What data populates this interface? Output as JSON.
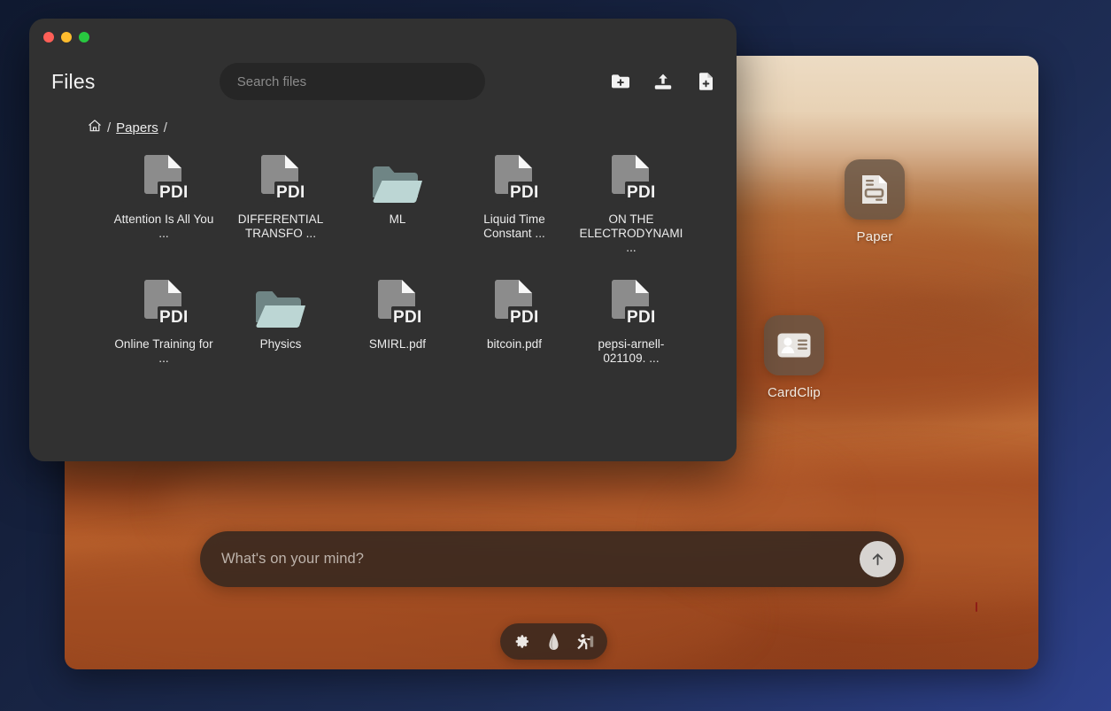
{
  "desktop": {
    "wallpaper_name": "desert-dunes-wallpaper",
    "icons": [
      {
        "id": "paper",
        "label": "Paper",
        "icon": "document-app-icon"
      },
      {
        "id": "cardclip",
        "label": "CardClip",
        "icon": "contact-card-app-icon"
      }
    ],
    "chat": {
      "placeholder": "What's on your mind?",
      "value": "",
      "send_icon": "arrow-up-icon"
    },
    "dock": {
      "items": [
        {
          "id": "settings",
          "icon": "gear-icon"
        },
        {
          "id": "lamp",
          "icon": "lamp-icon"
        },
        {
          "id": "exit",
          "icon": "exit-run-icon"
        }
      ]
    }
  },
  "files_window": {
    "title": "Files",
    "traffic_lights": [
      {
        "name": "close",
        "color": "#ff5f57"
      },
      {
        "name": "minimize",
        "color": "#febc2e"
      },
      {
        "name": "maximize",
        "color": "#28c840"
      }
    ],
    "search": {
      "placeholder": "Search files",
      "value": ""
    },
    "header_actions": [
      {
        "id": "new-folder",
        "icon": "folder-plus-icon"
      },
      {
        "id": "upload",
        "icon": "upload-icon"
      },
      {
        "id": "new-file",
        "icon": "file-plus-icon"
      }
    ],
    "breadcrumb": {
      "home_icon": "home-icon",
      "separator": "/",
      "path": [
        "Papers"
      ],
      "trailing_separator": "/"
    },
    "items": [
      {
        "name": "Attention Is All You ...",
        "type": "pdf",
        "badge": "PDF"
      },
      {
        "name": "DIFFERENTIAL TRANSFO ...",
        "type": "pdf",
        "badge": "PDF"
      },
      {
        "name": "ML",
        "type": "folder",
        "badge": ""
      },
      {
        "name": "Liquid Time Constant ...",
        "type": "pdf",
        "badge": "PDF"
      },
      {
        "name": "ON THE ELECTRODYNAMI ...",
        "type": "pdf",
        "badge": "PDF"
      },
      {
        "name": "Online Training for ...",
        "type": "pdf",
        "badge": "PDF"
      },
      {
        "name": "Physics",
        "type": "folder",
        "badge": ""
      },
      {
        "name": "SMIRL.pdf",
        "type": "pdf",
        "badge": "PDF"
      },
      {
        "name": "bitcoin.pdf",
        "type": "pdf",
        "badge": "PDF"
      },
      {
        "name": "pepsi-arnell-021109. ...",
        "type": "pdf",
        "badge": "PDF"
      }
    ]
  },
  "colors": {
    "outer_background": "#15203c",
    "window_background": "#313131",
    "search_background": "#262626",
    "pdf_icon": "#8c8c8c",
    "folder_back": "#6f8585",
    "folder_front": "#bcd6d4",
    "desktop_tile": "#685646",
    "accent_send": "#d7d4d1"
  }
}
